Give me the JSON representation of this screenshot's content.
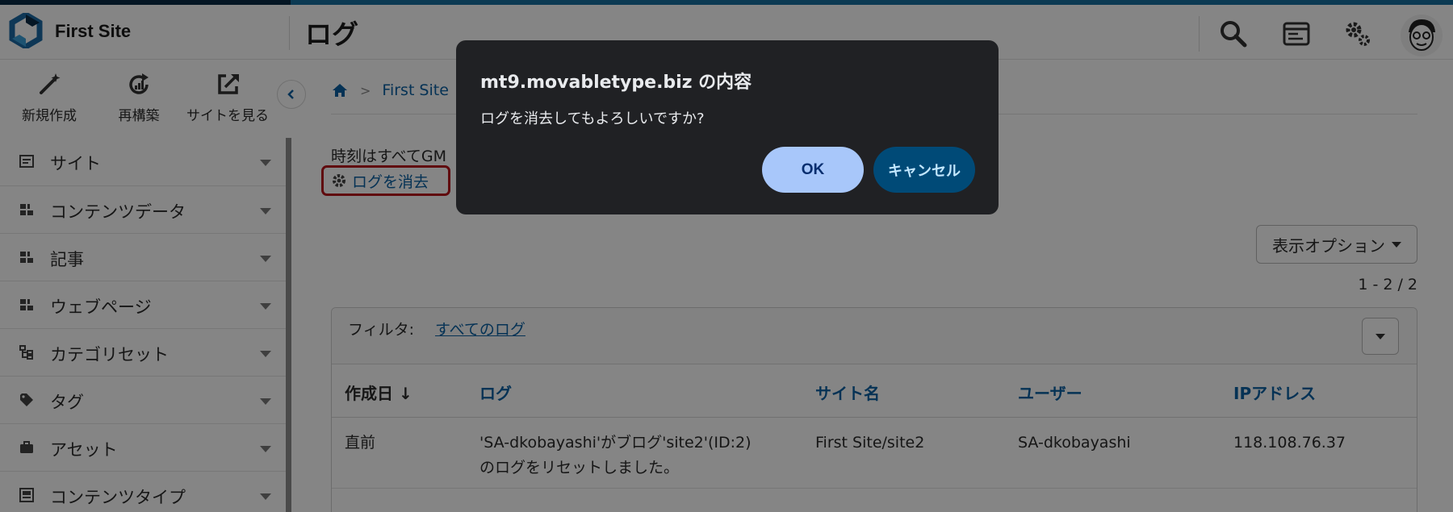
{
  "header": {
    "site_name": "First Site",
    "page_title": "ログ"
  },
  "sidebar": {
    "actions": [
      {
        "label": "新規作成",
        "icon": "magic-wand-icon"
      },
      {
        "label": "再構築",
        "icon": "rebuild-icon"
      },
      {
        "label": "サイトを見る",
        "icon": "external-link-icon"
      }
    ],
    "items": [
      {
        "label": "サイト",
        "icon": "site-icon"
      },
      {
        "label": "コンテンツデータ",
        "icon": "content-data-icon"
      },
      {
        "label": "記事",
        "icon": "entry-icon"
      },
      {
        "label": "ウェブページ",
        "icon": "webpage-icon"
      },
      {
        "label": "カテゴリセット",
        "icon": "category-set-icon"
      },
      {
        "label": "タグ",
        "icon": "tag-icon"
      },
      {
        "label": "アセット",
        "icon": "asset-icon"
      },
      {
        "label": "コンテンツタイプ",
        "icon": "content-type-icon"
      }
    ]
  },
  "breadcrumb": {
    "site": "First Site"
  },
  "main": {
    "timezone_note": "時刻はすべてGM",
    "clear_log_label": "ログを消去",
    "display_options_label": "表示オプション",
    "count": "1 - 2 / 2",
    "filter_label": "フィルタ:",
    "filter_value": "すべてのログ",
    "columns": [
      "作成日 ↓",
      "ログ",
      "サイト名",
      "ユーザー",
      "IPアドレス"
    ],
    "rows": [
      {
        "created": "直前",
        "log_line1": "'SA-dkobayashi'がブログ'site2'(ID:2)",
        "log_line2": "のログをリセットしました。",
        "site": "First Site/site2",
        "user": "SA-dkobayashi",
        "ip": "118.108.76.37"
      }
    ]
  },
  "dialog": {
    "title": "mt9.movabletype.biz の内容",
    "message": "ログを消去してもよろしいですか?",
    "ok_label": "OK",
    "cancel_label": "キャンセル"
  },
  "colors": {
    "accent": "#0a61a3",
    "highlight_border": "#b8151b",
    "dialog_bg": "#202124",
    "ok_bg": "#a8c7fa",
    "cancel_bg": "#004a77"
  }
}
